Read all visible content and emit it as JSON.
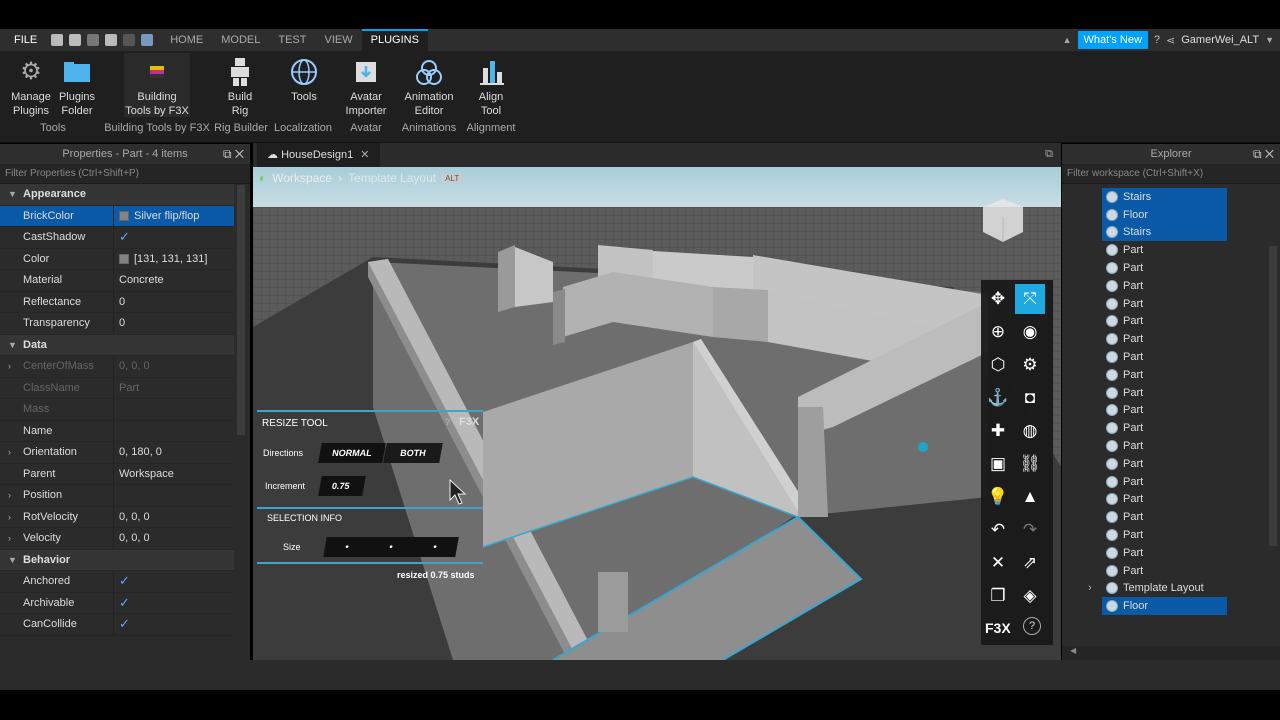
{
  "menu": {
    "file": "FILE",
    "tabs": [
      "HOME",
      "MODEL",
      "TEST",
      "VIEW",
      "PLUGINS"
    ],
    "active": "PLUGINS",
    "whats_new": "What's New",
    "user": "GamerWei_ALT"
  },
  "ribbon": {
    "buttons": [
      {
        "label1": "Manage",
        "label2": "Plugins",
        "icon": "gear-icon"
      },
      {
        "label1": "Plugins",
        "label2": "Folder",
        "icon": "folder-icon"
      },
      {
        "label1": "Building",
        "label2": "Tools by F3X",
        "icon": "f3x-icon"
      },
      {
        "label1": "Build",
        "label2": "Rig",
        "icon": "rig-icon"
      },
      {
        "label1": "Tools",
        "label2": "",
        "icon": "globe-icon"
      },
      {
        "label1": "Avatar",
        "label2": "Importer",
        "icon": "avatar-icon"
      },
      {
        "label1": "Animation",
        "label2": "Editor",
        "icon": "animation-icon"
      },
      {
        "label1": "Align",
        "label2": "Tool",
        "icon": "align-icon"
      }
    ],
    "groups": [
      "Tools",
      "Building Tools by F3X",
      "Rig Builder",
      "Localization",
      "Avatar",
      "Animations",
      "Alignment"
    ]
  },
  "properties": {
    "title": "Properties - Part - 4 items",
    "filter": "Filter Properties (Ctrl+Shift+P)",
    "rows": [
      {
        "type": "sec",
        "k": "Appearance"
      },
      {
        "k": "BrickColor",
        "v": "Silver flip/flop",
        "swatch": true,
        "sel": true
      },
      {
        "k": "CastShadow",
        "v": "✓",
        "check": true
      },
      {
        "k": "Color",
        "v": "[131, 131, 131]",
        "swatch": true
      },
      {
        "k": "Material",
        "v": "Concrete"
      },
      {
        "k": "Reflectance",
        "v": "0"
      },
      {
        "k": "Transparency",
        "v": "0"
      },
      {
        "type": "sec",
        "k": "Data"
      },
      {
        "k": "CenterOfMass",
        "v": "0, 0, 0",
        "dim": true,
        "arrow": true
      },
      {
        "k": "ClassName",
        "v": "Part",
        "dim": true
      },
      {
        "k": "Mass",
        "v": "",
        "dim": true
      },
      {
        "k": "Name",
        "v": ""
      },
      {
        "k": "Orientation",
        "v": "0, 180, 0",
        "arrow": true
      },
      {
        "k": "Parent",
        "v": "Workspace"
      },
      {
        "k": "Position",
        "v": "",
        "arrow": true
      },
      {
        "k": "RotVelocity",
        "v": "0, 0, 0",
        "arrow": true
      },
      {
        "k": "Velocity",
        "v": "0, 0, 0",
        "arrow": true
      },
      {
        "type": "sec",
        "k": "Behavior"
      },
      {
        "k": "Anchored",
        "v": "✓",
        "check": true
      },
      {
        "k": "Archivable",
        "v": "✓",
        "check": true
      },
      {
        "k": "CanCollide",
        "v": "✓",
        "check": true
      }
    ]
  },
  "doc_tab": "HouseDesign1",
  "breadcrumb": {
    "a": "Workspace",
    "b": "Template Layout",
    "badge": "ALT"
  },
  "f3x": {
    "title": "RESIZE TOOL",
    "brand": "F3X",
    "directions": "Directions",
    "normal": "NORMAL",
    "both": "BOTH",
    "increment": "Increment",
    "increment_val": "0.75",
    "selection": "SELECTION INFO",
    "size": "Size",
    "status": "resized 0.75 studs",
    "toolbar_brand": "F3X"
  },
  "explorer": {
    "title": "Explorer",
    "filter": "Filter workspace (Ctrl+Shift+X)",
    "items": [
      {
        "label": "Stairs",
        "sel": true
      },
      {
        "label": "Floor",
        "sel": true
      },
      {
        "label": "Stairs",
        "sel": true
      },
      {
        "label": "Part"
      },
      {
        "label": "Part"
      },
      {
        "label": "Part"
      },
      {
        "label": "Part"
      },
      {
        "label": "Part"
      },
      {
        "label": "Part"
      },
      {
        "label": "Part"
      },
      {
        "label": "Part"
      },
      {
        "label": "Part"
      },
      {
        "label": "Part"
      },
      {
        "label": "Part"
      },
      {
        "label": "Part"
      },
      {
        "label": "Part"
      },
      {
        "label": "Part"
      },
      {
        "label": "Part"
      },
      {
        "label": "Part"
      },
      {
        "label": "Part"
      },
      {
        "label": "Part"
      },
      {
        "label": "Part"
      },
      {
        "label": "Template Layout",
        "arrow": true
      },
      {
        "label": "Floor",
        "sel": true
      }
    ]
  }
}
